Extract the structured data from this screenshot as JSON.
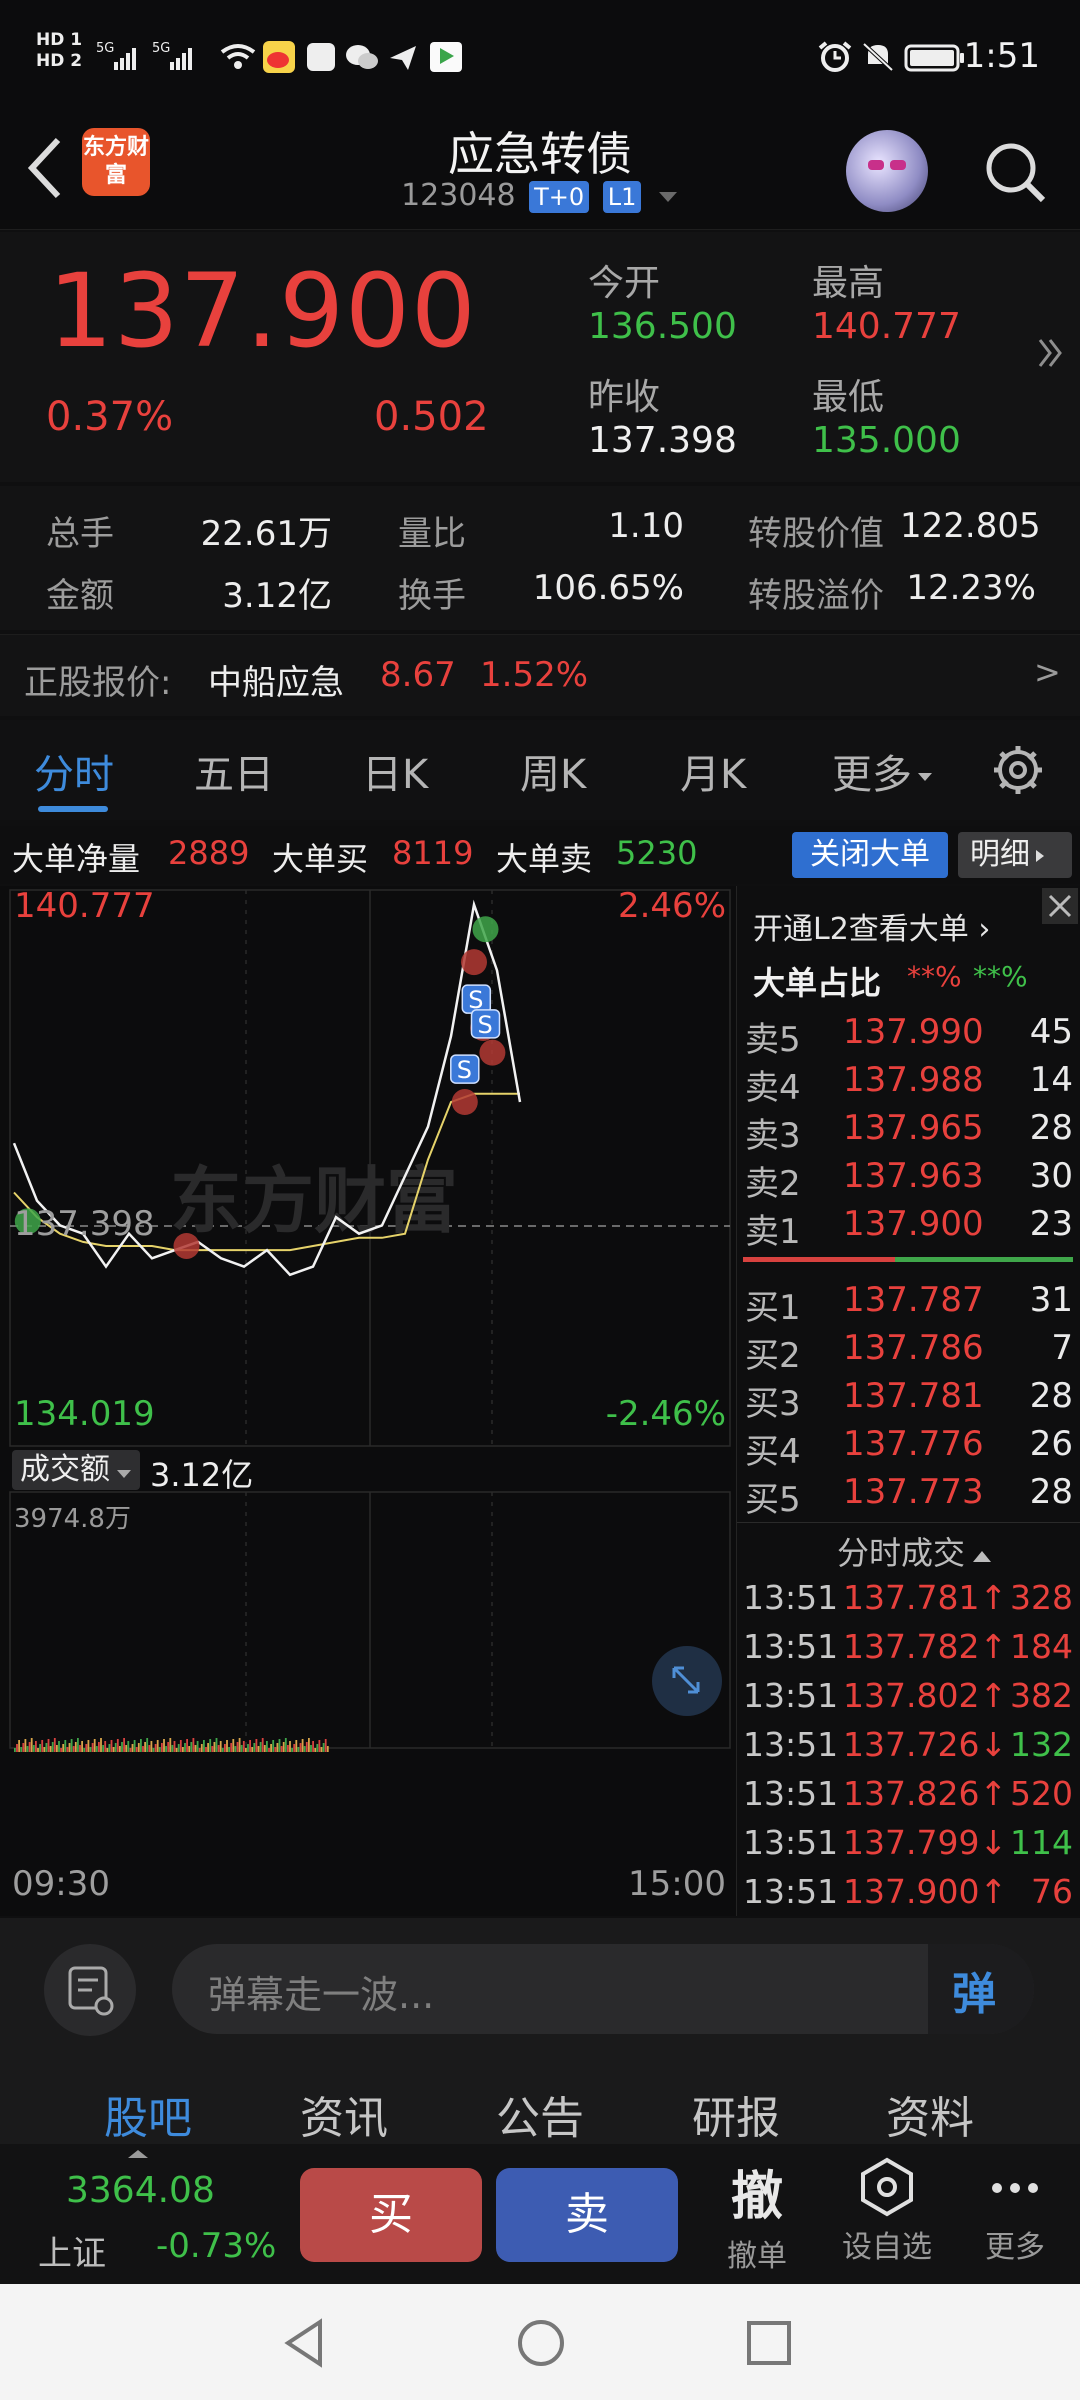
{
  "status": {
    "time": "1:51",
    "left_icons": [
      "HD1",
      "HD2",
      "5G",
      "5G",
      "wifi-icon",
      "weibo-icon",
      "app-icon",
      "wechat-icon",
      "send-icon",
      "app2-icon"
    ],
    "right_icons": [
      "alarm-icon",
      "mute-icon",
      "battery-icon"
    ]
  },
  "header": {
    "title": "应急转债",
    "code": "123048",
    "tags": [
      "T+0",
      "L1"
    ],
    "logo_text": "东方财富"
  },
  "quote": {
    "price": "137.900",
    "pct": "0.37%",
    "change": "0.502",
    "open_label": "今开",
    "open": "136.500",
    "high_label": "最高",
    "high": "140.777",
    "prevclose_label": "昨收",
    "prevclose": "137.398",
    "low_label": "最低",
    "low": "135.000"
  },
  "stats": {
    "vol_label": "总手",
    "vol": "22.61万",
    "ratio_label": "量比",
    "ratio": "1.10",
    "convval_label": "转股价值",
    "convval": "122.805",
    "amount_label": "金额",
    "amount": "3.12亿",
    "turnover_label": "换手",
    "turnover": "106.65%",
    "premium_label": "转股溢价",
    "premium": "12.23%"
  },
  "stock": {
    "label": "正股报价:",
    "name": "中船应急",
    "price": "8.67",
    "pct": "1.52%",
    "arrow": ">"
  },
  "tabs": [
    "分时",
    "五日",
    "日K",
    "周K",
    "月K",
    "更多"
  ],
  "bigorder": {
    "net_label": "大单净量",
    "net": "2889",
    "buy_label": "大单买",
    "buy": "8119",
    "sell_label": "大单卖",
    "sell": "5230",
    "close_btn": "关闭大单",
    "detail_btn": "明细"
  },
  "chart": {
    "top_price": "140.777",
    "top_pct": "2.46%",
    "mid_price": "137.398",
    "bottom_price": "134.019",
    "bottom_pct": "-2.46%",
    "watermark": "东方财富",
    "volume_select": "成交额",
    "volume_total": "3.12亿",
    "volume_max": "3974.8万",
    "time_start": "09:30",
    "time_end": "15:00"
  },
  "chart_data": {
    "type": "line",
    "title": "",
    "xlabel": "",
    "ylabel": "",
    "ylim": [
      134.019,
      140.777
    ],
    "x_range": [
      "09:30",
      "15:00"
    ],
    "series": [
      {
        "values": [
          137.7,
          137.0,
          136.7,
          136.6,
          136.2,
          136.6,
          136.3,
          136.4,
          136.5,
          136.3,
          136.2,
          136.4,
          136.1,
          136.2,
          136.8,
          136.6,
          136.7,
          137.3,
          137.9,
          139.0,
          140.6,
          139.8,
          138.2
        ]
      },
      {
        "values": [
          137.1,
          136.8,
          136.6,
          136.5,
          136.45,
          136.45,
          136.45,
          136.4,
          136.4,
          136.4,
          136.4,
          136.4,
          136.4,
          136.45,
          136.5,
          136.55,
          136.55,
          136.6,
          137.5,
          138.2,
          138.3,
          138.3,
          138.3
        ]
      }
    ]
  },
  "orderbook": {
    "link_text": "开通L2查看大单",
    "ratio_label": "大单占比",
    "ratio_red": "**%",
    "ratio_green": "**%",
    "asks": [
      {
        "label": "卖5",
        "price": "137.990",
        "vol": "45"
      },
      {
        "label": "卖4",
        "price": "137.988",
        "vol": "14"
      },
      {
        "label": "卖3",
        "price": "137.965",
        "vol": "28"
      },
      {
        "label": "卖2",
        "price": "137.963",
        "vol": "30"
      },
      {
        "label": "卖1",
        "price": "137.900",
        "vol": "23"
      }
    ],
    "bids": [
      {
        "label": "买1",
        "price": "137.787",
        "vol": "31"
      },
      {
        "label": "买2",
        "price": "137.786",
        "vol": "7"
      },
      {
        "label": "买3",
        "price": "137.781",
        "vol": "28"
      },
      {
        "label": "买4",
        "price": "137.776",
        "vol": "26"
      },
      {
        "label": "买5",
        "price": "137.773",
        "vol": "28"
      }
    ],
    "trades_title": "分时成交",
    "trades": [
      {
        "time": "13:51",
        "price": "137.781↑",
        "vol": "328",
        "dir": "up"
      },
      {
        "time": "13:51",
        "price": "137.782↑",
        "vol": "184",
        "dir": "up"
      },
      {
        "time": "13:51",
        "price": "137.802↑",
        "vol": "382",
        "dir": "up"
      },
      {
        "time": "13:51",
        "price": "137.726↓",
        "vol": "132",
        "dir": "down"
      },
      {
        "time": "13:51",
        "price": "137.826↑",
        "vol": "520",
        "dir": "up"
      },
      {
        "time": "13:51",
        "price": "137.799↓",
        "vol": "114",
        "dir": "down"
      },
      {
        "time": "13:51",
        "price": "137.900↑",
        "vol": "76",
        "dir": "up"
      }
    ]
  },
  "inputbar": {
    "placeholder": "弹幕走一波...",
    "danmu": "弹"
  },
  "subtabs": [
    "股吧",
    "资讯",
    "公告",
    "研报",
    "资料"
  ],
  "bottom": {
    "index_value": "3364.08",
    "index_name": "上证",
    "index_pct": "-0.73%",
    "buy": "买",
    "sell": "卖",
    "cancel_big": "撤",
    "cancel_label": "撤单",
    "watch_label": "设自选",
    "more_label": "更多"
  },
  "colors": {
    "red": "#e8413d",
    "green": "#3fc04a",
    "blue": "#3e8bdc",
    "avg_line": "#e6d36a"
  }
}
